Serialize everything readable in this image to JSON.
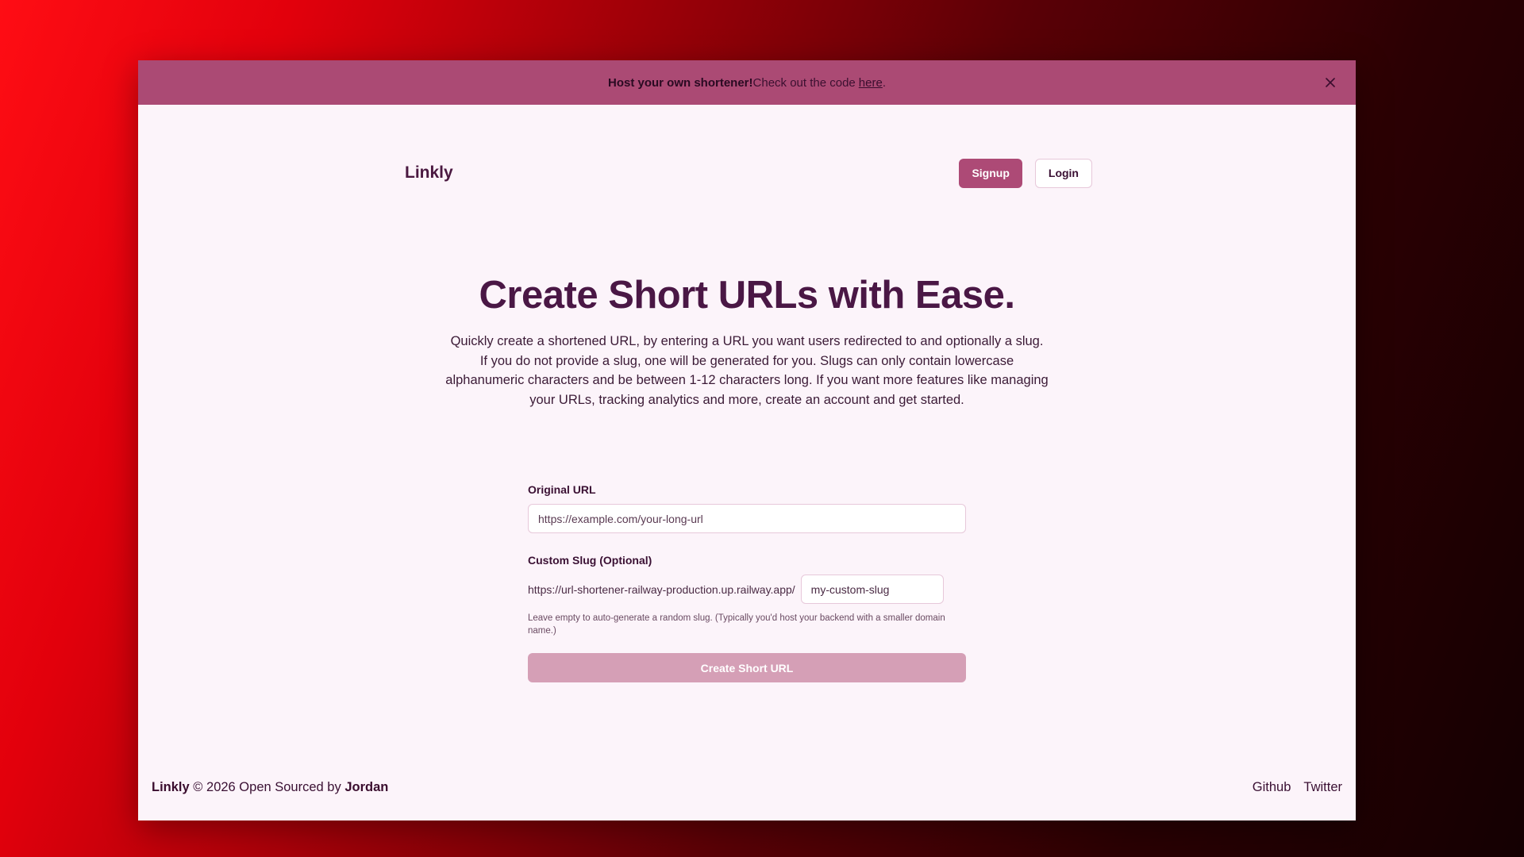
{
  "banner": {
    "strong_text": "Host your own shortener!",
    "text": " Check out the code",
    "link_text": "here",
    "after_link": ".",
    "close_icon": "close-icon"
  },
  "nav": {
    "logo": "Linkly",
    "signup_label": "Signup",
    "login_label": "Login"
  },
  "hero": {
    "title": "Create Short URLs with Ease.",
    "description": "Quickly create a shortened URL, by entering a URL you want users redirected to and optionally a slug. If you do not provide a slug, one will be generated for you. Slugs can only contain lowercase alphanumeric characters and be between 1-12 characters long. If you want more features like managing your URLs, tracking analytics and more, create an account and get started."
  },
  "form": {
    "original_url_label": "Original URL",
    "original_url_placeholder": "https://example.com/your-long-url",
    "original_url_value": "",
    "slug_label": "Custom Slug (Optional)",
    "slug_prefix": "https://url-shortener-railway-production.up.railway.app/",
    "slug_placeholder": "my-custom-slug",
    "slug_value": "",
    "hint": "Leave empty to auto-generate a random slug. (Typically you'd host your backend with a smaller domain name.)",
    "submit_label": "Create Short URL"
  },
  "footer": {
    "brand": "Linkly",
    "copyright": " © 2026 Open Sourced by ",
    "author": "Jordan",
    "links": [
      "Github",
      "Twitter"
    ]
  },
  "colors": {
    "banner_bg": "#ab4a74",
    "accent": "#ad4a76",
    "page_bg": "#fcf4fa",
    "title": "#4a1745",
    "disabled_button": "#d59fb6"
  }
}
